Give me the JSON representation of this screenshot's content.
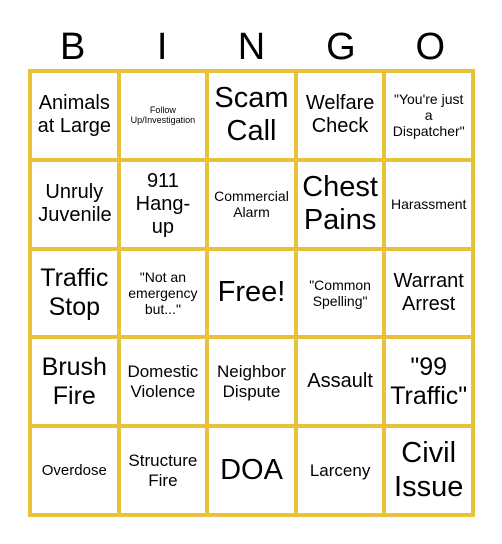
{
  "header": {
    "letters": [
      "B",
      "I",
      "N",
      "G",
      "O"
    ]
  },
  "colors": {
    "grid": "#E8C33A",
    "cell_background": "#FFFFFF",
    "text": "#000000"
  },
  "board": {
    "rows": [
      [
        "Animals at Large",
        "Follow Up/Investigation",
        "Scam Call",
        "Welfare Check",
        "\"You're just a Dispatcher\""
      ],
      [
        "Unruly Juvenile",
        "911 Hang-up",
        "Commercial Alarm",
        "Chest Pains",
        "Harassment"
      ],
      [
        "Traffic Stop",
        "\"Not an emergency but...\"",
        "Free!",
        "\"Common Spelling\"",
        "Warrant Arrest"
      ],
      [
        "Brush Fire",
        "Domestic Violence",
        "Neighbor Dispute",
        "Assault",
        "\"99 Traffic\""
      ],
      [
        "Overdose",
        "Structure Fire",
        "DOA",
        "Larceny",
        "Civil Issue"
      ]
    ]
  }
}
